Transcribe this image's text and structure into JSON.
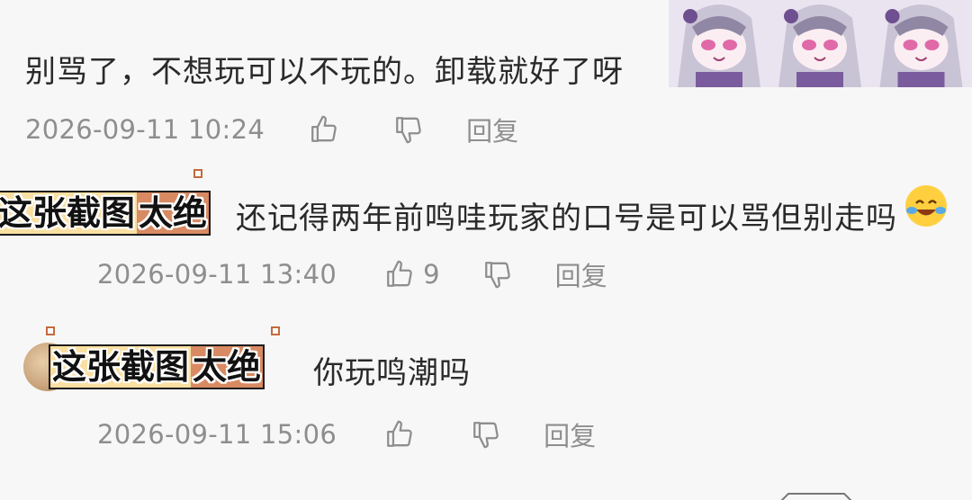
{
  "comments": [
    {
      "text": "别骂了，不想玩可以不玩的。卸载就好了呀",
      "time": "2026-09-11 10:24",
      "like_count": "",
      "reply_label": "回复"
    },
    {
      "text": "还记得两年前鸣哇玩家的口号是可以骂但别走吗",
      "emoji": "cry-laugh-emoji",
      "time": "2026-09-11 13:40",
      "like_count": "9",
      "reply_label": "回复"
    },
    {
      "text": "你玩鸣潮吗",
      "time": "2026-09-11 15:06",
      "like_count": "",
      "reply_label": "回复"
    }
  ],
  "caption": {
    "part1": "这张截图",
    "part2": "太绝"
  },
  "colors": {
    "caption_yellow": "#f9dfa1",
    "caption_orange": "#d88a63",
    "meta_gray": "#8e8e8e"
  }
}
